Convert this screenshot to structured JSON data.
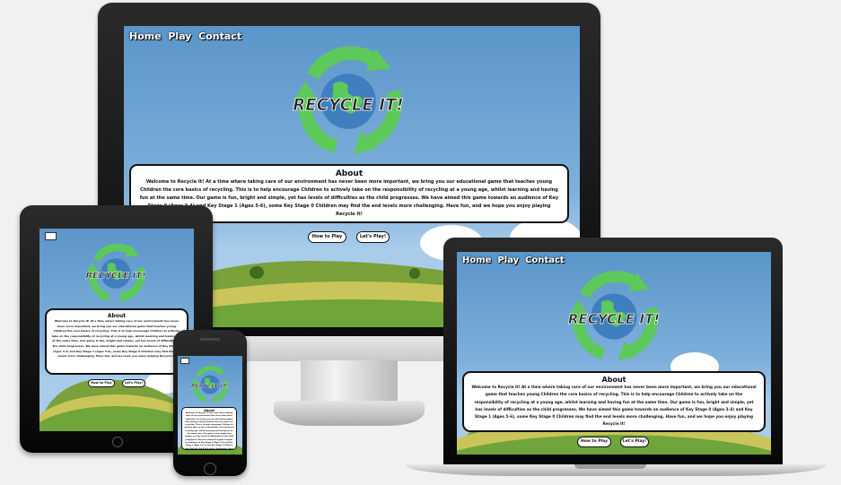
{
  "site": {
    "nav": [
      "Home",
      "Play",
      "Contact"
    ],
    "logo_text": "RECYCLE IT!",
    "about_title": "About",
    "about_text": "Welcome to Recycle It! At a time where taking care of our environment has never been more important, we bring you our educational game that teaches young Children the core basics of recycling. This is to help encourage Children to actively take on the responsibility of recycling at a young age, whilst learning and having fun at the same time. Our game is fun, bright and simple, yet has levels of difficulties as the child progresses. We have aimed this game towards an audience of Key Stage 0 (Ages 3-4) and Key Stage 1 (Ages 5-6), some Key Stage 0 Children may find the end levels more challenging. Have fun, and we hope you enjoy playing Recycle It!",
    "how_to_play": "How to Play",
    "lets_play": "Let's Play!"
  },
  "colors": {
    "sky_top": "#5b95c9",
    "logo_green": "#5cc95a",
    "logo_dark_green": "#2f8f33",
    "earth_blue": "#3f7fc0",
    "grass": "#6fa53a",
    "field": "#c9c55a"
  },
  "devices": [
    "desktop-monitor",
    "tablet",
    "laptop",
    "phone"
  ]
}
